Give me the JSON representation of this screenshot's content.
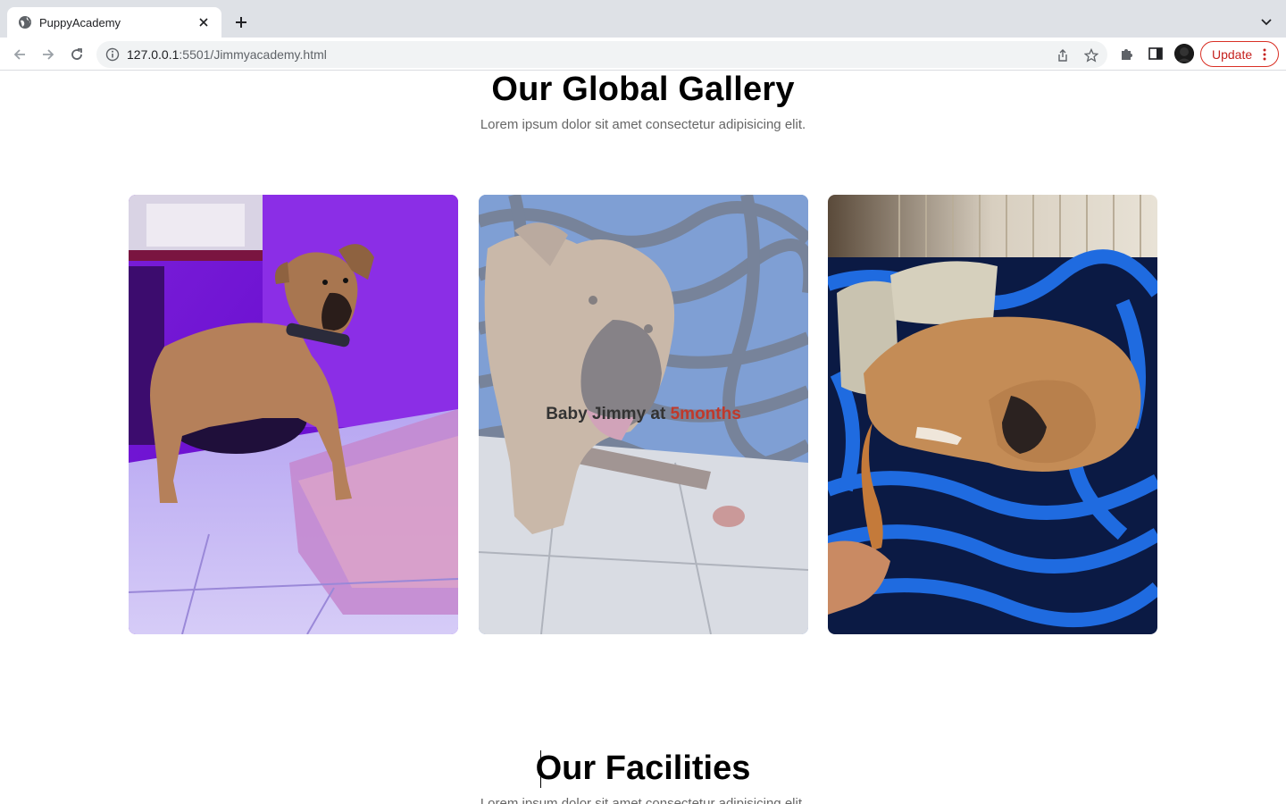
{
  "browser": {
    "tab_title": "PuppyAcademy",
    "url_host": "127.0.0.1",
    "url_path": ":5501/Jimmyacademy.html",
    "update_label": "Update",
    "update_color": "#d93025"
  },
  "gallery": {
    "title": "Our Global Gallery",
    "subtitle": "Lorem ipsum dolor sit amet consectetur adipisicing elit.",
    "cards": [
      {
        "photo": "puppy-standing-purple-light",
        "caption": ""
      },
      {
        "photo": "puppy-closeup-zebra-couch",
        "caption_main": "Baby Jimmy at ",
        "caption_accent": "5months",
        "accent_color": "#c0392b"
      },
      {
        "photo": "dog-sleeping-blue-zebra-couch",
        "caption": ""
      }
    ]
  },
  "facilities": {
    "title": "Our Facilities",
    "subtitle": "Lorem ipsum dolor sit amet consectetur adipisicing elit."
  }
}
